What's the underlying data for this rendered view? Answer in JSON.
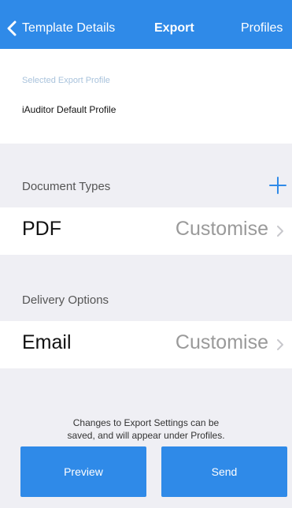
{
  "nav": {
    "back_label": "Template Details",
    "title": "Export",
    "right_label": "Profiles"
  },
  "profile": {
    "caption": "Selected Export Profile",
    "value": "iAuditor Default Profile"
  },
  "document_types": {
    "header": "Document Types",
    "add_icon": "plus-icon",
    "items": [
      {
        "label": "PDF",
        "action": "Customise"
      }
    ]
  },
  "delivery_options": {
    "header": "Delivery Options",
    "items": [
      {
        "label": "Email",
        "action": "Customise"
      }
    ]
  },
  "footnote": {
    "line1": "Changes to Export Settings can be",
    "line2": "saved, and will appear under Profiles."
  },
  "buttons": {
    "preview": "Preview",
    "send": "Send"
  },
  "colors": {
    "accent": "#2f8ae8",
    "background": "#efeff4",
    "muted_text": "#9a9a9a",
    "caption_text": "#a9c3dc"
  }
}
